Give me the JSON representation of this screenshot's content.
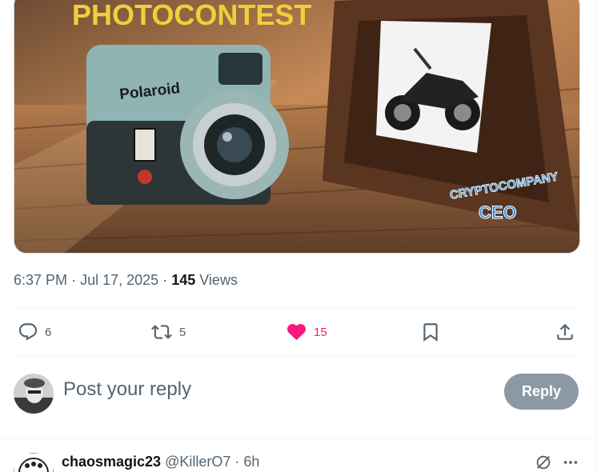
{
  "media": {
    "banner_text": "PHOTOCONTEST",
    "camera_brand": "Polaroid",
    "watermark_line1": "CRYPTOCOMPANY",
    "watermark_line2": "CEO"
  },
  "tweet_meta": {
    "time": "6:37 PM",
    "sep1": "·",
    "date": "Jul 17, 2025",
    "sep2": "·",
    "views_count": "145",
    "views_label": "Views"
  },
  "actions": {
    "reply_count": "6",
    "retweet_count": "5",
    "like_count": "15",
    "liked": true,
    "like_color": "#f91880"
  },
  "compose": {
    "placeholder": "Post your reply",
    "reply_button_label": "Reply",
    "reply_button_color": "#8b98a5"
  },
  "comment": {
    "display_name": "chaosmagic23",
    "handle": "@KillerO7",
    "separator": "·",
    "age": "6h"
  },
  "icons": [
    "reply-icon",
    "retweet-icon",
    "heart-icon",
    "bookmark-icon",
    "share-icon",
    "grok-icon",
    "more-icon"
  ]
}
